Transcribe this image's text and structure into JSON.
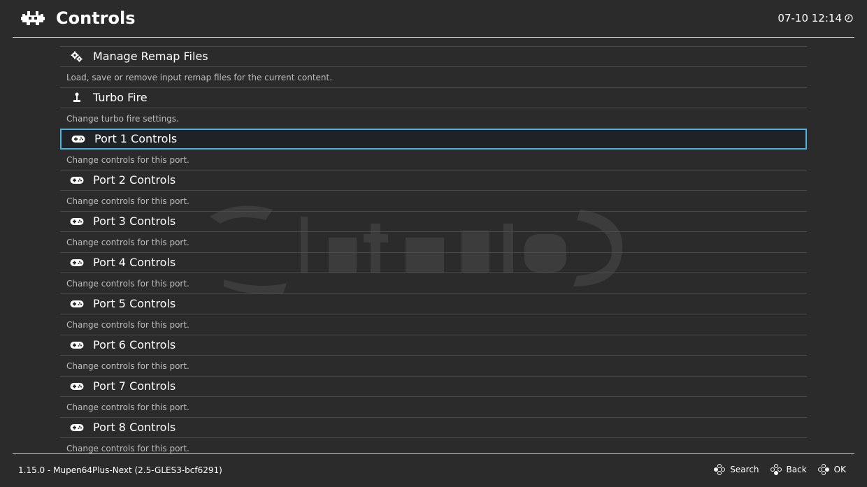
{
  "header": {
    "title": "Controls",
    "clock": "07-10 12:14",
    "logo_icon": "retroarch-invader-icon",
    "clock_icon": "clock-icon"
  },
  "menu": {
    "items": [
      {
        "label": "Manage Remap Files",
        "sublabel": "Load, save or remove input remap files for the current content.",
        "icon": "gears-icon",
        "selected": false
      },
      {
        "label": "Turbo Fire",
        "sublabel": "Change turbo fire settings.",
        "icon": "joystick-icon",
        "selected": false
      },
      {
        "label": "Port 1 Controls",
        "sublabel": "Change controls for this port.",
        "icon": "gamepad-icon",
        "selected": true
      },
      {
        "label": "Port 2 Controls",
        "sublabel": "Change controls for this port.",
        "icon": "gamepad-icon",
        "selected": false
      },
      {
        "label": "Port 3 Controls",
        "sublabel": "Change controls for this port.",
        "icon": "gamepad-icon",
        "selected": false
      },
      {
        "label": "Port 4 Controls",
        "sublabel": "Change controls for this port.",
        "icon": "gamepad-icon",
        "selected": false
      },
      {
        "label": "Port 5 Controls",
        "sublabel": "Change controls for this port.",
        "icon": "gamepad-icon",
        "selected": false
      },
      {
        "label": "Port 6 Controls",
        "sublabel": "Change controls for this port.",
        "icon": "gamepad-icon",
        "selected": false
      },
      {
        "label": "Port 7 Controls",
        "sublabel": "Change controls for this port.",
        "icon": "gamepad-icon",
        "selected": false
      },
      {
        "label": "Port 8 Controls",
        "sublabel": "Change controls for this port.",
        "icon": "gamepad-icon",
        "selected": false
      }
    ]
  },
  "footer": {
    "version": "1.15.0 - Mupen64Plus-Next (2.5-GLES3-bcf6291)",
    "actions": [
      {
        "label": "Search",
        "icon": "dpad-icon"
      },
      {
        "label": "Back",
        "icon": "dpad-icon"
      },
      {
        "label": "OK",
        "icon": "dpad-icon"
      }
    ]
  },
  "colors": {
    "background": "#2b2b2b",
    "selection_border": "#4fb3d9",
    "text": "#ffffff",
    "subtext": "#bdbdbd"
  }
}
